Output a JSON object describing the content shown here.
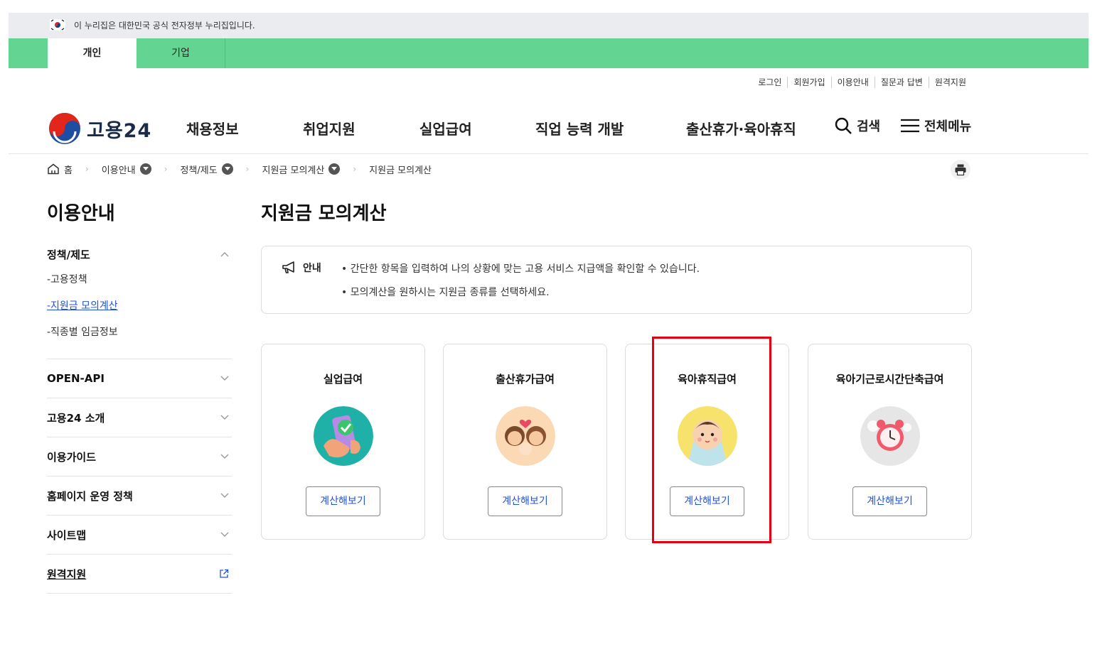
{
  "gov_banner": {
    "text": "이 누리집은 대한민국 공식 전자정부 누리집입니다."
  },
  "category_tabs": [
    {
      "label": "개인"
    },
    {
      "label": "기업"
    }
  ],
  "util_links": [
    {
      "label": "로그인"
    },
    {
      "label": "회원가입"
    },
    {
      "label": "이용안내"
    },
    {
      "label": "질문과 답변"
    },
    {
      "label": "원격지원"
    }
  ],
  "logo": {
    "text": "고용24"
  },
  "gnb": {
    "items": [
      {
        "label": "채용정보"
      },
      {
        "label": "취업지원"
      },
      {
        "label": "실업급여"
      },
      {
        "label": "직업 능력 개발"
      },
      {
        "label": "출산휴가·육아휴직"
      }
    ],
    "search_label": "검색",
    "menu_label": "전체메뉴"
  },
  "breadcrumb": [
    {
      "label": "홈"
    },
    {
      "label": "이용안내"
    },
    {
      "label": "정책/제도"
    },
    {
      "label": "지원금 모의계산"
    },
    {
      "label": "지원금 모의계산"
    }
  ],
  "sidebar": {
    "title": "이용안내",
    "groups": [
      {
        "label": "정책/제도",
        "sub": [
          {
            "label": "-고용정책"
          },
          {
            "label": "-지원금 모의계산"
          },
          {
            "label": "-직종별 임금정보"
          }
        ]
      },
      {
        "label": "OPEN-API"
      },
      {
        "label": "고용24 소개"
      },
      {
        "label": "이용가이드"
      },
      {
        "label": "홈페이지 운영 정책"
      },
      {
        "label": "사이트맵"
      },
      {
        "label": "원격지원"
      }
    ]
  },
  "main": {
    "title": "지원금 모의계산",
    "notice": {
      "label": "안내",
      "lines": [
        "• 간단한 항목을 입력하여 나의 상황에 맞는 고용 서비스 지급액을 확인할 수 있습니다.",
        "• 모의계산을 원하시는 지원금 종류를 선택하세요."
      ]
    },
    "cards": [
      {
        "title": "실업급여",
        "button": "계산해보기",
        "icon": "phone-check-icon"
      },
      {
        "title": "출산휴가급여",
        "button": "계산해보기",
        "icon": "parents-baby-icon"
      },
      {
        "title": "육아휴직급여",
        "button": "계산해보기",
        "icon": "baby-icon"
      },
      {
        "title": "육아기근로시간단축급여",
        "button": "계산해보기",
        "icon": "alarm-clock-icon"
      }
    ]
  },
  "colors": {
    "category_bar": "#63d491",
    "link_blue": "#2253d6",
    "highlight": "#e60012"
  }
}
